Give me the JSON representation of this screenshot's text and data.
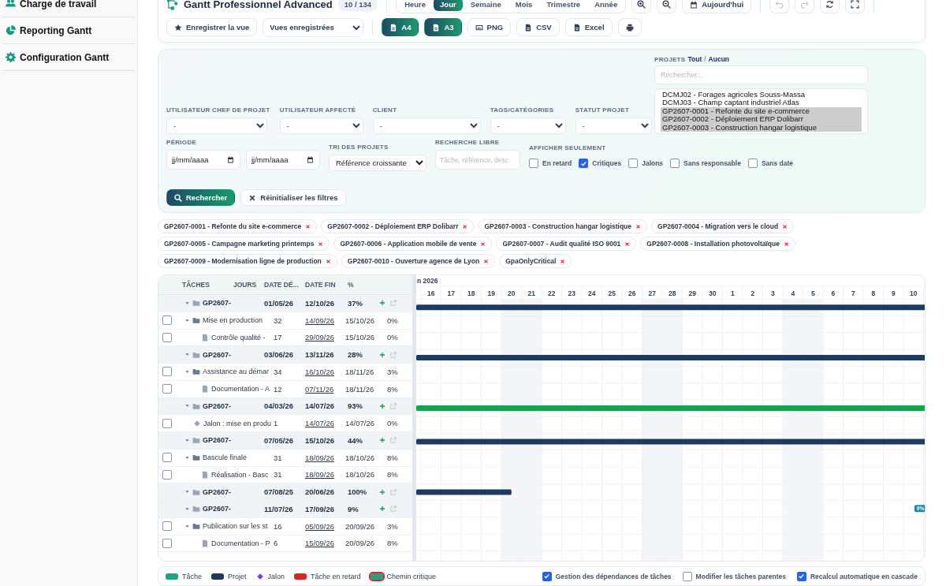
{
  "sidebar": {
    "items": [
      {
        "label": "Charge de travail",
        "kind": "workload"
      },
      {
        "label": "Reporting Gantt",
        "kind": "reporting"
      },
      {
        "label": "Configuration Gantt",
        "kind": "config"
      }
    ]
  },
  "header": {
    "title": "Gantt Professionnel Advanced",
    "count": "10 / 134",
    "views": [
      {
        "label": "Heure",
        "selected": false
      },
      {
        "label": "Jour",
        "selected": true
      },
      {
        "label": "Semaine",
        "selected": false
      },
      {
        "label": "Mois",
        "selected": false
      },
      {
        "label": "Trimestre",
        "selected": false
      },
      {
        "label": "Année",
        "selected": false
      }
    ],
    "today": "Aujourd'hui",
    "tools": [
      {
        "kind": "undo",
        "disabled": true
      },
      {
        "kind": "redo",
        "disabled": true
      },
      {
        "kind": "refresh",
        "disabled": false
      },
      {
        "kind": "fullscreen",
        "disabled": false
      }
    ],
    "save_view": "Enregistrer la vue",
    "saved_views": "Vues enregistrées",
    "exports": [
      {
        "label": "A4",
        "kind": "pdf"
      },
      {
        "label": "A3",
        "kind": "pdf"
      },
      {
        "label": "PNG",
        "kind": "image"
      },
      {
        "label": "CSV",
        "kind": "csv"
      },
      {
        "label": "Excel",
        "kind": "excel"
      },
      {
        "kind": "print"
      }
    ]
  },
  "filters": {
    "selects": [
      {
        "label": "UTILISATEUR CHEF DE PROJET",
        "value": "-"
      },
      {
        "label": "UTILISATEUR AFFECTÉ",
        "value": "-"
      },
      {
        "label": "CLIENT",
        "value": "-"
      },
      {
        "label": "TAGS/CATÉGORIES",
        "value": "-"
      },
      {
        "label": "STATUT PROJET",
        "value": "-"
      }
    ],
    "period": {
      "label": "PÉRIODE",
      "from": {
        "placeholder": "jj/mm/aaaa"
      },
      "to": {
        "placeholder": "jj/mm/aaaa"
      }
    },
    "sort": {
      "label": "TRI DES PROJETS",
      "value": "Référence croissante"
    },
    "search": {
      "label": "RECHERCHE LIBRE",
      "placeholder": "Tâche, référence, desc"
    },
    "show_only": {
      "label": "AFFICHER SEULEMENT",
      "options": [
        {
          "label": "En retard",
          "checked": false
        },
        {
          "label": "Critiques",
          "checked": true
        },
        {
          "label": "Jalons",
          "checked": false
        },
        {
          "label": "Sans responsable",
          "checked": false
        },
        {
          "label": "Sans date",
          "checked": false
        }
      ]
    },
    "projects": {
      "label": "PROJETS",
      "all": "Tout",
      "separator": "/",
      "none": "Aucun",
      "search": {
        "placeholder": "Rechercher..."
      },
      "items": [
        {
          "label": "DCMJ02 - Forages agricoles Souss-Massa",
          "selected": false
        },
        {
          "label": "DCMJ03 - Champ captant industriel Atlas",
          "selected": false
        },
        {
          "label": "GP2607-0001 - Refonte du site e-commerce",
          "selected": true
        },
        {
          "label": "GP2607-0002 - Déploiement ERP Dolibarr",
          "selected": true
        },
        {
          "label": "GP2607-0003 - Construction hangar logistique",
          "selected": true
        }
      ]
    },
    "search_button": "Rechercher",
    "reset_button": "Réinitialiser les filtres"
  },
  "chips": [
    {
      "label": "GP2607-0001 - Refonte du site e-commerce"
    },
    {
      "label": "GP2607-0002 - Déploiement ERP Dolibarr"
    },
    {
      "label": "GP2607-0003 - Construction hangar logistique"
    },
    {
      "label": "GP2607-0004 - Migration vers le cloud"
    },
    {
      "label": "GP2607-0005 - Campagne marketing printemps"
    },
    {
      "label": "GP2607-0006 - Application mobile de vente"
    },
    {
      "label": "GP2607-0007 - Audit qualité ISO 9001"
    },
    {
      "label": "GP2607-0008 - Installation photovoltaïque"
    },
    {
      "label": "GP2607-0009 - Modernisation ligne de production"
    },
    {
      "label": "GP2607-0010 - Ouverture agence de Lyon"
    },
    {
      "label": "GpaOnlyCritical"
    }
  ],
  "gantt": {
    "columns": [
      "TÂCHES",
      "JOURS",
      "DATE DÉ...",
      "DATE FIN",
      "%"
    ],
    "timeline": {
      "month": "n 2026",
      "days": [
        {
          "label": "16",
          "weekend": false
        },
        {
          "label": "17",
          "weekend": false
        },
        {
          "label": "18",
          "weekend": false
        },
        {
          "label": "19",
          "weekend": false
        },
        {
          "label": "20",
          "weekend": true
        },
        {
          "label": "21",
          "weekend": true
        },
        {
          "label": "22",
          "weekend": false
        },
        {
          "label": "23",
          "weekend": false
        },
        {
          "label": "24",
          "weekend": false
        },
        {
          "label": "25",
          "weekend": false
        },
        {
          "label": "26",
          "weekend": false
        },
        {
          "label": "27",
          "weekend": true
        },
        {
          "label": "28",
          "weekend": true
        },
        {
          "label": "29",
          "weekend": false
        },
        {
          "label": "30",
          "weekend": false
        },
        {
          "label": "1",
          "weekend": false
        },
        {
          "label": "2",
          "weekend": false
        },
        {
          "label": "3",
          "weekend": false
        },
        {
          "label": "4",
          "weekend": true
        },
        {
          "label": "5",
          "weekend": true
        },
        {
          "label": "6",
          "weekend": false
        },
        {
          "label": "7",
          "weekend": false
        },
        {
          "label": "8",
          "weekend": false
        },
        {
          "label": "9",
          "weekend": false
        },
        {
          "label": "10",
          "weekend": false
        }
      ]
    },
    "rows": [
      {
        "kind": "project",
        "name": "GP2607-",
        "start": "01/05/26",
        "end": "12/10/26",
        "percent": "37%",
        "expanded": true,
        "color": "#1e3a5f"
      },
      {
        "kind": "folder",
        "checked": false,
        "expanded": true,
        "name": "Mise en production",
        "days": "32",
        "start": "14/09/26",
        "end": "15/10/26",
        "percent": "0%"
      },
      {
        "kind": "task",
        "checked": false,
        "name": "Contrôle qualité -",
        "days": "17",
        "start": "29/09/26",
        "end": "15/10/26",
        "percent": "0%"
      },
      {
        "kind": "project",
        "name": "GP2607-",
        "start": "03/06/26",
        "end": "13/11/26",
        "percent": "28%",
        "expanded": true,
        "color": "#1e3a5f"
      },
      {
        "kind": "folder",
        "checked": false,
        "expanded": true,
        "name": "Assistance au démar",
        "days": "34",
        "start": "16/10/26",
        "end": "18/11/26",
        "percent": "3%"
      },
      {
        "kind": "task",
        "checked": false,
        "name": "Documentation - A",
        "days": "12",
        "start": "07/11/26",
        "end": "18/11/26",
        "percent": "8%"
      },
      {
        "kind": "project",
        "name": "GP2607-",
        "start": "04/03/26",
        "end": "14/07/26",
        "percent": "93%",
        "expanded": true,
        "color": "#16a34a"
      },
      {
        "kind": "milestone",
        "checked": false,
        "name": "Jalon : mise en produ",
        "days": "1",
        "start": "14/07/26",
        "end": "14/07/26",
        "percent": "0%"
      },
      {
        "kind": "project",
        "name": "GP2607-",
        "start": "07/05/26",
        "end": "15/10/26",
        "percent": "44%",
        "expanded": true,
        "color": "#1e3a5f"
      },
      {
        "kind": "folder",
        "checked": false,
        "expanded": true,
        "name": "Bascule finale",
        "days": "31",
        "start": "18/09/26",
        "end": "18/10/26",
        "percent": "8%"
      },
      {
        "kind": "task",
        "checked": false,
        "name": "Réalisation - Basc",
        "days": "31",
        "start": "18/09/26",
        "end": "18/10/26",
        "percent": "8%"
      },
      {
        "kind": "project",
        "name": "GP2607-",
        "start": "07/08/25",
        "end": "20/06/26",
        "percent": "100%",
        "expanded": true,
        "color": "#1e3a5f"
      },
      {
        "kind": "project",
        "name": "GP2607-",
        "start": "11/07/26",
        "end": "17/09/26",
        "percent": "9%",
        "expanded": true,
        "color": "#1b8aa0",
        "bar_label": "9%"
      },
      {
        "kind": "folder",
        "checked": false,
        "expanded": true,
        "name": "Publication sur les st",
        "days": "16",
        "start": "05/09/26",
        "end": "20/09/26",
        "percent": "3%"
      },
      {
        "kind": "task",
        "checked": false,
        "name": "Documentation - P",
        "days": "6",
        "start": "15/09/26",
        "end": "20/09/26",
        "percent": "8%"
      }
    ]
  },
  "legend": {
    "items": [
      {
        "label": "Tâche",
        "kind": "task"
      },
      {
        "label": "Projet",
        "kind": "project"
      },
      {
        "label": "Jalon",
        "kind": "milestone"
      },
      {
        "label": "Tâche en retard",
        "kind": "late"
      },
      {
        "label": "Chemin critique",
        "kind": "critical"
      }
    ],
    "options": [
      {
        "label": "Gestion des dépendances de tâches",
        "checked": true
      },
      {
        "label": "Modifier les tâches parentes",
        "checked": false
      },
      {
        "label": "Recalcul automatique en cascade",
        "checked": true
      }
    ]
  }
}
